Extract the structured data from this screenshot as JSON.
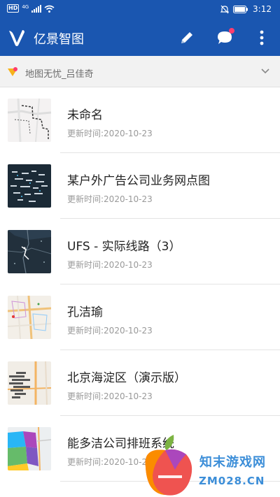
{
  "status_bar": {
    "left_badge_hd": "HD",
    "left_badge_4g": "4G",
    "time": "3:12"
  },
  "app_bar": {
    "title": "亿景智图",
    "icons": [
      "logo-icon",
      "edit-icon",
      "message-icon",
      "more-vert-icon"
    ],
    "accent_color": "#1a56b0"
  },
  "account": {
    "label": "地图无忧_吕佳奇",
    "icon": "badge-icon"
  },
  "maps": [
    {
      "title": "未命名",
      "updated": "更新时间:2020-10-23"
    },
    {
      "title": "某户外广告公司业务网点图",
      "updated": "更新时间:2020-10-23"
    },
    {
      "title": "UFS - 实际线路（3）",
      "updated": "更新时间:2020-10-23"
    },
    {
      "title": "孔洁瑜",
      "updated": "更新时间:2020-10-23"
    },
    {
      "title": "北京海淀区（演示版）",
      "updated": "更新时间:2020-10-23"
    },
    {
      "title": "能多洁公司排班系统",
      "updated": "更新时间:2020-10-23"
    }
  ],
  "watermark": {
    "line1": "知末游戏网",
    "line2": "ZM028.CN"
  }
}
